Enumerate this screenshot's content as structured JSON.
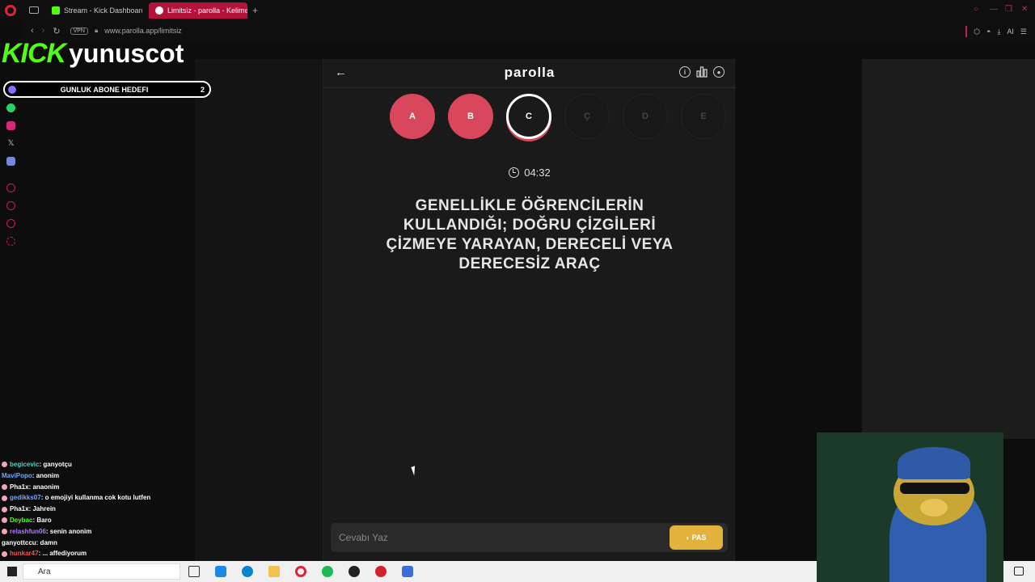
{
  "browser": {
    "tabs": [
      {
        "label": "Stream - Kick Dashboard",
        "active": false,
        "icon": "kick-icon"
      },
      {
        "label": "Limitsiz - parolla - Kelime",
        "active": true,
        "icon": "parolla-icon"
      }
    ],
    "new_tab_label": "+",
    "vpn_label": "VPN",
    "url": "www.parolla.app/limitsiz",
    "ai_label": "AI"
  },
  "overlay": {
    "kick_text": "KICK",
    "channel_name": "yunuscot",
    "sub_goal_label": "GUNLUK ABONE HEDEFI",
    "sub_goal_count": "2"
  },
  "app": {
    "brand": "parolla",
    "letters": [
      {
        "char": "A",
        "state": "done"
      },
      {
        "char": "B",
        "state": "done"
      },
      {
        "char": "C",
        "state": "current"
      },
      {
        "char": "Ç",
        "state": "pending"
      },
      {
        "char": "D",
        "state": "pending"
      },
      {
        "char": "E",
        "state": "pending"
      }
    ],
    "timer": "04:32",
    "question_lines": [
      "GENELLİKLE ÖĞRENCİLERİN",
      "KULLANDIĞI; DOĞRU ÇİZGİLERİ",
      "ÇİZMEYE YARAYAN, DERECELİ VEYA",
      "DERECESİZ ARAÇ"
    ],
    "answer_placeholder": "Cevabı Yaz",
    "pass_label": "PAS",
    "accent_color": "#d9475c",
    "pass_color": "#e3b23c"
  },
  "chat": [
    {
      "user": "begicevic",
      "user_color": "#4fd1c5",
      "message": " : ganyotçu",
      "badge": true
    },
    {
      "user": "MaviPopo",
      "user_color": "#6fa8ff",
      "message": " : anonim",
      "badge": false
    },
    {
      "user": "Pha1x",
      "user_color": "#ffffff",
      "message": " : anaonim",
      "badge": true
    },
    {
      "user": "gedikks07",
      "user_color": "#6fa8ff",
      "message": " : o emojiyi kullanma cok kotu lutfen",
      "badge": true
    },
    {
      "user": "Pha1x",
      "user_color": "#ffffff",
      "message": " : Jahrein",
      "badge": true
    },
    {
      "user": "Deybac",
      "user_color": "#53fc18",
      "message": " : Baro",
      "badge": true
    },
    {
      "user": "relashfun06",
      "user_color": "#b07cff",
      "message": " : senin anonim",
      "badge": true
    },
    {
      "user": "ganyottccu",
      "user_color": "#ffffff",
      "message": " : damn",
      "badge": false
    },
    {
      "user": "hunkar47",
      "user_color": "#ff5050",
      "message": " : ... affediyorum",
      "badge": true
    }
  ],
  "taskbar": {
    "search_label": "Ara"
  }
}
